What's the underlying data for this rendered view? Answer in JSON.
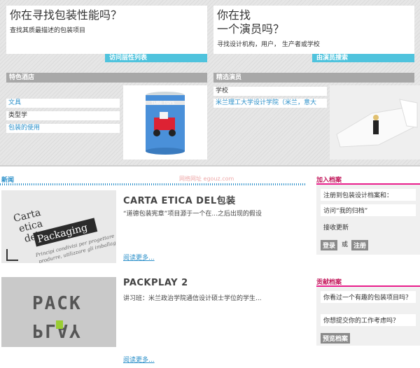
{
  "left_hero": {
    "title": "你在寻找包装性能吗？",
    "subtitle": "查找其质最描述的包装项目",
    "button": "访问层性列表"
  },
  "right_hero": {
    "title_line1": "你在找",
    "title_line2": "一个演员吗？",
    "subtitle": "寻找设计机构，用户， 生产者或学校",
    "button": "由演员搜索"
  },
  "left_list": {
    "header": "特色酒店",
    "items": [
      "",
      "文具",
      "类型学",
      "包装的使用"
    ]
  },
  "product_image": {
    "label": "TUBE TOYS",
    "icon": "tube-toys-product-image"
  },
  "right_list": {
    "header": "精选演员",
    "items": [
      "学校",
      "米兰理工大学设计学院（米兰，意大"
    ]
  },
  "news": {
    "header": "新闻"
  },
  "articles": [
    {
      "title": "CARTA ETICA DEL包装",
      "desc": "“道德包装宪章”项目源于一个在...之后出现的假设",
      "more": "阅读更多..."
    },
    {
      "title": "PACKPLAY 2",
      "desc": "讲习班：米兰政治学院通信设计硕士学位的学生...",
      "more": "阅读更多..."
    }
  ],
  "join": {
    "header": "加入档案",
    "items": [
      "注册到包装设计档案和：",
      "访问“我的归档”",
      "接收更新"
    ],
    "login": "登录",
    "or": "或",
    "register": "注册"
  },
  "contribute": {
    "header": "贡献档案",
    "items": [
      "你看过一个有趣的包装项目吗？",
      "你想提交你的工作考虑吗？"
    ],
    "button": "预览档案"
  },
  "watermark": "网络网址 egouz.com",
  "colors": {
    "accent_cyan": "#4fc3dd",
    "link_blue": "#2a8fc9",
    "side_pink": "#e91e8c"
  }
}
